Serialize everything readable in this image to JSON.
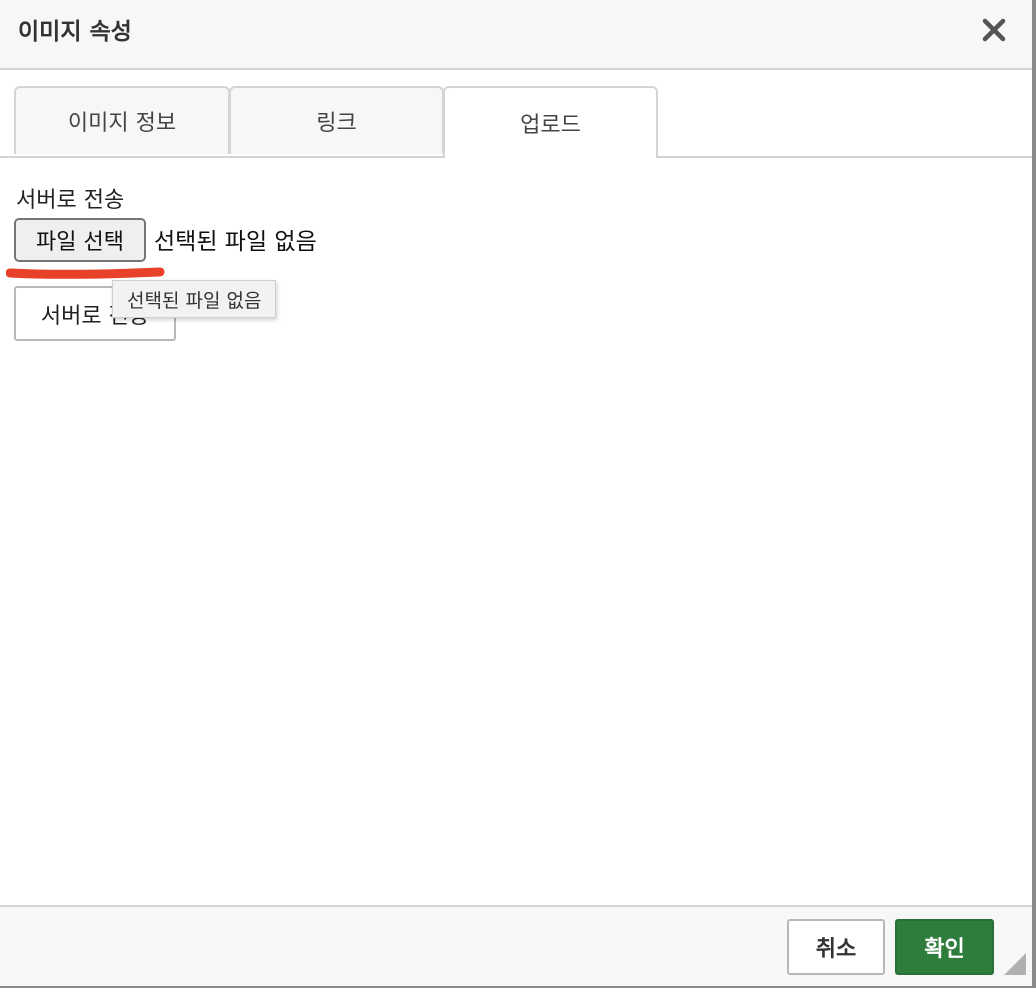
{
  "dialog": {
    "title": "이미지 속성"
  },
  "tabs": [
    {
      "label": "이미지 정보",
      "active": false
    },
    {
      "label": "링크",
      "active": false
    },
    {
      "label": "업로드",
      "active": true
    }
  ],
  "upload": {
    "section_label": "서버로 전송",
    "choose_file_label": "파일 선택",
    "no_file_text": "선택된 파일 없음",
    "send_button_label": "서버로 전송",
    "tooltip_text": "선택된 파일 없음"
  },
  "footer": {
    "cancel_label": "취소",
    "ok_label": "확인"
  },
  "colors": {
    "accent": "#2e7d3c",
    "annotation": "#e8412a"
  },
  "icons": {
    "close": "close-icon",
    "resize": "resize-handle-icon"
  }
}
